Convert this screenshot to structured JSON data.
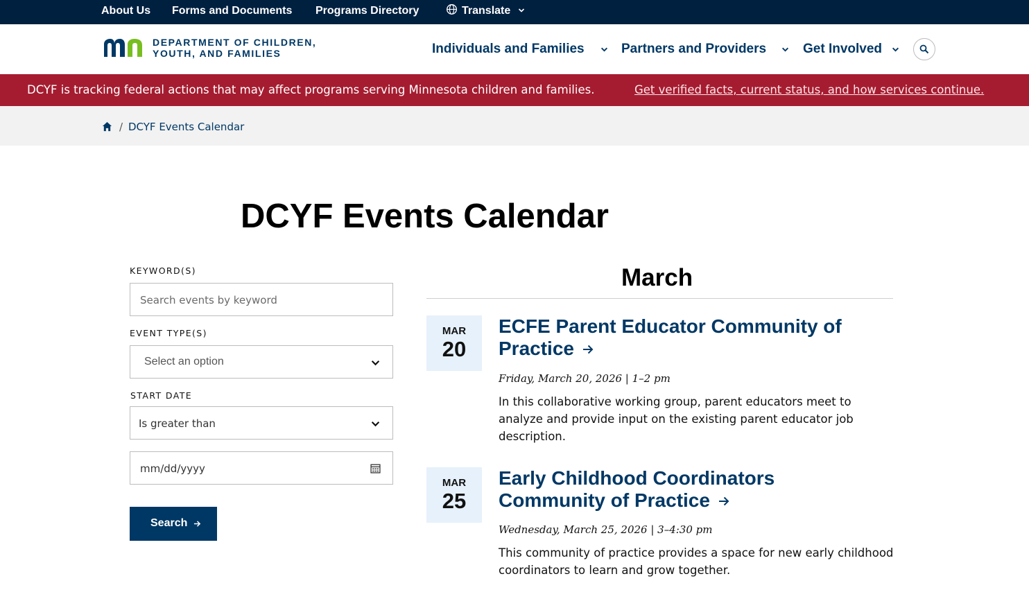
{
  "utility_nav": {
    "about": "About Us",
    "forms": "Forms and Documents",
    "programs": "Programs Directory",
    "translate": "Translate"
  },
  "header": {
    "logo_line1": "DEPARTMENT OF CHILDREN,",
    "logo_line2": "YOUTH, AND FAMILIES",
    "nav": [
      "Individuals and Families",
      "Partners and Providers",
      "Get Involved"
    ]
  },
  "alert": {
    "message": "DCYF is tracking federal actions that may affect programs serving Minnesota children and families.",
    "link": "Get verified facts, current status, and how services continue."
  },
  "breadcrumb": {
    "separator": "/",
    "current": "DCYF Events Calendar"
  },
  "page_title": "DCYF Events Calendar",
  "filters": {
    "keyword_label": "KEYWORD(S)",
    "keyword_placeholder": "Search events by keyword",
    "event_type_label": "EVENT TYPE(S)",
    "event_type_value": "Select an option",
    "start_date_label": "START DATE",
    "start_date_operator": "Is greater than",
    "date_placeholder": "mm/dd/yyyy",
    "search_label": "Search"
  },
  "events": {
    "month_heading": "March",
    "items": [
      {
        "month": "MAR",
        "day": "20",
        "title": "ECFE Parent Educator Community of Practice",
        "when": "Friday, March 20, 2026 | 1–2 pm",
        "description": "In this collaborative working group, parent educators meet to analyze and provide input on the existing parent educator job description."
      },
      {
        "month": "MAR",
        "day": "25",
        "title": "Early Childhood Coordinators Community of Practice",
        "when": "Wednesday, March 25, 2026 | 3–4:30 pm",
        "description": "This community of practice provides a space for new early childhood coordinators to learn and grow together."
      }
    ]
  },
  "colors": {
    "navy": "#002040",
    "brand_blue": "#003865",
    "brand_green": "#78be20",
    "alert_red": "#a51c30",
    "date_box": "#e6f1fb"
  }
}
